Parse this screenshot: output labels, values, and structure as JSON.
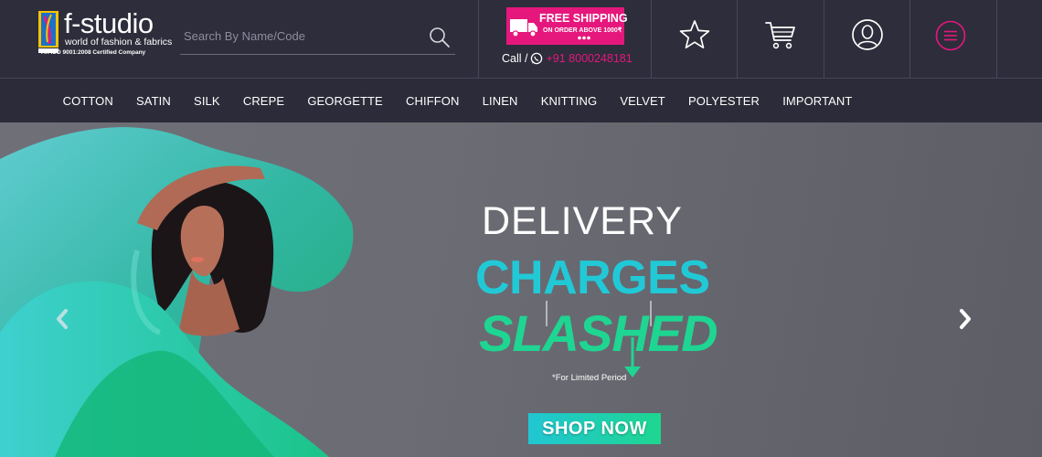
{
  "brand": {
    "name": "f-studio",
    "tagline": "world of fashion & fabrics",
    "certification": "An ISO 9001:2008 Certified Company",
    "pink": "#e5177c",
    "dark": "#2d2d3b"
  },
  "search": {
    "placeholder": "Search By Name/Code",
    "value": "",
    "icon": "search-icon"
  },
  "shipping": {
    "title": "FREE SHIPPING",
    "subtitle": "ON ORDER ABOVE 1000₹",
    "icon": "truck-icon"
  },
  "contact": {
    "call_label": "Call /",
    "phone": "+91 8000248181",
    "icon": "whatsapp-icon"
  },
  "header_icons": [
    {
      "name": "wishlist",
      "icon": "star-icon"
    },
    {
      "name": "cart",
      "icon": "cart-icon"
    },
    {
      "name": "account",
      "icon": "user-icon"
    },
    {
      "name": "menu",
      "icon": "hamburger-menu-icon"
    }
  ],
  "nav": {
    "items": [
      "COTTON",
      "SATIN",
      "SILK",
      "CREPE",
      "GEORGETTE",
      "CHIFFON",
      "LINEN",
      "KNITTING",
      "VELVET",
      "POLYESTER",
      "IMPORTANT"
    ]
  },
  "hero": {
    "line1": "DELIVERY",
    "line2": "CHARGES",
    "line3": "SLASHED",
    "note": "*For Limited Period",
    "cta": "SHOP NOW",
    "colors": {
      "teal": "#21c9d6",
      "green": "#1fd592"
    }
  }
}
